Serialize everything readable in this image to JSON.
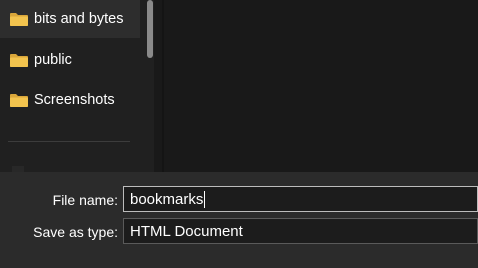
{
  "nav": {
    "items": [
      {
        "label": "bits and bytes",
        "icon": "folder-icon",
        "selected": true
      },
      {
        "label": "public",
        "icon": "folder-icon",
        "selected": false
      },
      {
        "label": "Screenshots",
        "icon": "folder-icon",
        "selected": false
      }
    ]
  },
  "form": {
    "filename_label": "File name:",
    "filename_value": "bookmarks",
    "savetype_label": "Save as type:",
    "savetype_value": "HTML Document"
  },
  "colors": {
    "folder_yellow": "#f2c34e",
    "folder_dark": "#d9a63a"
  }
}
